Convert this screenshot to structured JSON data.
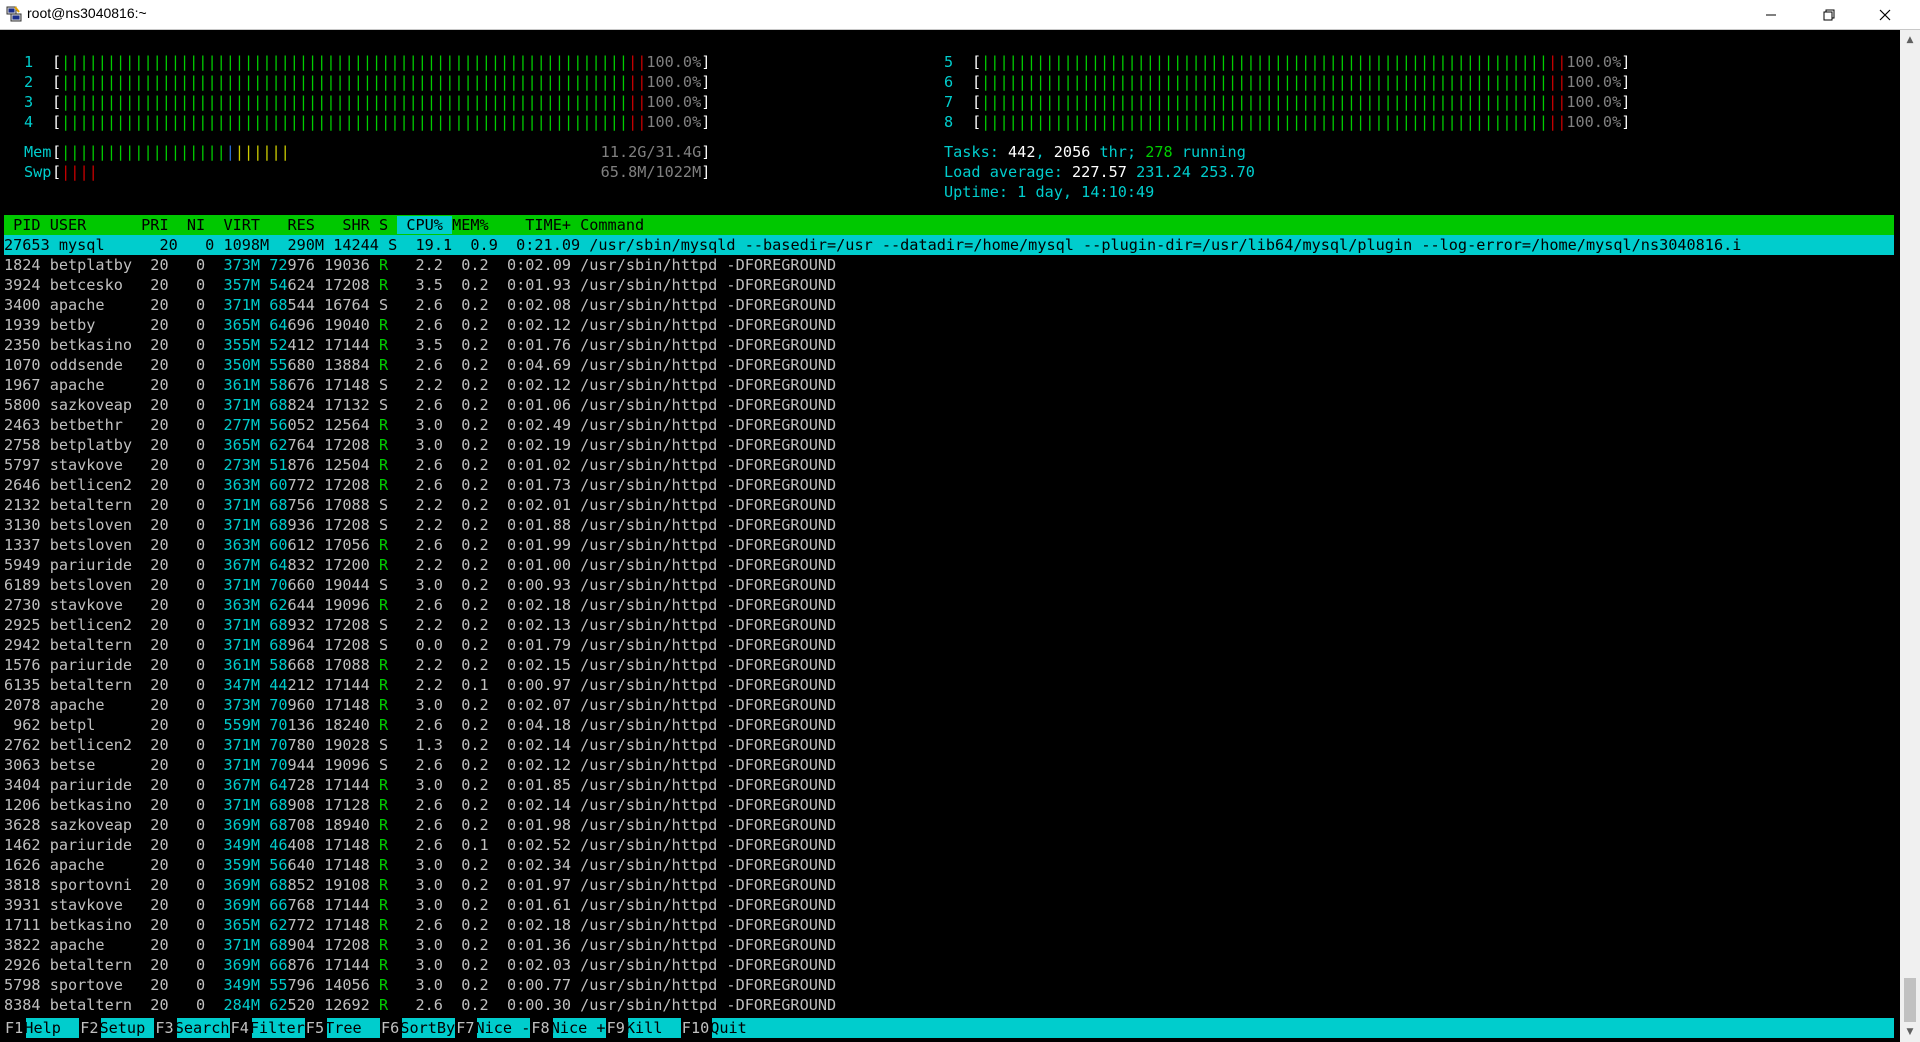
{
  "window": {
    "title": "root@ns3040816:~",
    "icons": {
      "app": "putty-icon",
      "minimize": "minimize-icon",
      "restore": "restore-icon",
      "close": "close-icon"
    }
  },
  "cpus": [
    {
      "id": "1",
      "pct": "100.0%"
    },
    {
      "id": "2",
      "pct": "100.0%"
    },
    {
      "id": "3",
      "pct": "100.0%"
    },
    {
      "id": "4",
      "pct": "100.0%"
    },
    {
      "id": "5",
      "pct": "100.0%"
    },
    {
      "id": "6",
      "pct": "100.0%"
    },
    {
      "id": "7",
      "pct": "100.0%"
    },
    {
      "id": "8",
      "pct": "100.0%"
    }
  ],
  "mem": {
    "label": "Mem",
    "value": "11.2G/31.4G",
    "fraction": 0.36
  },
  "swp": {
    "label": "Swp",
    "value": "65.8M/1022M",
    "fraction": 0.064
  },
  "tasks": {
    "label": "Tasks:",
    "count": "442",
    "sep": ",",
    "threads": "2056",
    "thr_label": "thr;",
    "running": "278",
    "running_label": "running"
  },
  "load": {
    "label": "Load average:",
    "v1": "227.57",
    "v2": "231.24",
    "v3": "253.70"
  },
  "uptime": {
    "label": "Uptime:",
    "value": "1 day, 14:10:49"
  },
  "columns": [
    " PID",
    "USER",
    "PRI",
    "NI",
    "VIRT",
    "RES",
    "SHR",
    "S",
    "CPU%",
    "MEM%",
    "TIME+",
    "Command"
  ],
  "selected": {
    "pid": "27653",
    "user": "mysql",
    "pri": "20",
    "ni": "0",
    "virt": "1098M",
    "res": "290M",
    "shr": "14244",
    "s": "S",
    "cpu": "19.1",
    "mem": "0.9",
    "time": "0:21.09",
    "cmd": "/usr/sbin/mysqld --basedir=/usr --datadir=/home/mysql --plugin-dir=/usr/lib64/mysql/plugin --log-error=/home/mysql/ns3040816.i"
  },
  "processes": [
    {
      "pid": "1824",
      "user": "betplatby",
      "pri": "20",
      "ni": "0",
      "virt": "373M",
      "res": "72976",
      "shr": "19036",
      "s": "R",
      "cpu": "2.2",
      "mem": "0.2",
      "time": "0:02.09",
      "cmd": "/usr/sbin/httpd -DFOREGROUND"
    },
    {
      "pid": "3924",
      "user": "betcesko",
      "pri": "20",
      "ni": "0",
      "virt": "357M",
      "res": "54624",
      "shr": "17208",
      "s": "R",
      "cpu": "3.5",
      "mem": "0.2",
      "time": "0:01.93",
      "cmd": "/usr/sbin/httpd -DFOREGROUND"
    },
    {
      "pid": "3400",
      "user": "apache",
      "pri": "20",
      "ni": "0",
      "virt": "371M",
      "res": "68544",
      "shr": "16764",
      "s": "S",
      "cpu": "2.6",
      "mem": "0.2",
      "time": "0:02.08",
      "cmd": "/usr/sbin/httpd -DFOREGROUND"
    },
    {
      "pid": "1939",
      "user": "betby",
      "pri": "20",
      "ni": "0",
      "virt": "365M",
      "res": "64696",
      "shr": "19040",
      "s": "R",
      "cpu": "2.6",
      "mem": "0.2",
      "time": "0:02.12",
      "cmd": "/usr/sbin/httpd -DFOREGROUND"
    },
    {
      "pid": "2350",
      "user": "betkasino",
      "pri": "20",
      "ni": "0",
      "virt": "355M",
      "res": "52412",
      "shr": "17144",
      "s": "R",
      "cpu": "3.5",
      "mem": "0.2",
      "time": "0:01.76",
      "cmd": "/usr/sbin/httpd -DFOREGROUND"
    },
    {
      "pid": "1070",
      "user": "oddsende",
      "pri": "20",
      "ni": "0",
      "virt": "350M",
      "res": "55680",
      "shr": "13884",
      "s": "R",
      "cpu": "2.6",
      "mem": "0.2",
      "time": "0:04.69",
      "cmd": "/usr/sbin/httpd -DFOREGROUND"
    },
    {
      "pid": "1967",
      "user": "apache",
      "pri": "20",
      "ni": "0",
      "virt": "361M",
      "res": "58676",
      "shr": "17148",
      "s": "S",
      "cpu": "2.2",
      "mem": "0.2",
      "time": "0:02.12",
      "cmd": "/usr/sbin/httpd -DFOREGROUND"
    },
    {
      "pid": "5800",
      "user": "sazkoveap",
      "pri": "20",
      "ni": "0",
      "virt": "371M",
      "res": "68824",
      "shr": "17132",
      "s": "S",
      "cpu": "2.6",
      "mem": "0.2",
      "time": "0:01.06",
      "cmd": "/usr/sbin/httpd -DFOREGROUND"
    },
    {
      "pid": "2463",
      "user": "betbethr",
      "pri": "20",
      "ni": "0",
      "virt": "277M",
      "res": "56052",
      "shr": "12564",
      "s": "R",
      "cpu": "3.0",
      "mem": "0.2",
      "time": "0:02.49",
      "cmd": "/usr/sbin/httpd -DFOREGROUND"
    },
    {
      "pid": "2758",
      "user": "betplatby",
      "pri": "20",
      "ni": "0",
      "virt": "365M",
      "res": "62764",
      "shr": "17208",
      "s": "R",
      "cpu": "3.0",
      "mem": "0.2",
      "time": "0:02.19",
      "cmd": "/usr/sbin/httpd -DFOREGROUND"
    },
    {
      "pid": "5797",
      "user": "stavkove",
      "pri": "20",
      "ni": "0",
      "virt": "273M",
      "res": "51876",
      "shr": "12504",
      "s": "R",
      "cpu": "2.6",
      "mem": "0.2",
      "time": "0:01.02",
      "cmd": "/usr/sbin/httpd -DFOREGROUND"
    },
    {
      "pid": "2646",
      "user": "betlicen2",
      "pri": "20",
      "ni": "0",
      "virt": "363M",
      "res": "60772",
      "shr": "17208",
      "s": "R",
      "cpu": "2.6",
      "mem": "0.2",
      "time": "0:01.73",
      "cmd": "/usr/sbin/httpd -DFOREGROUND"
    },
    {
      "pid": "2132",
      "user": "betaltern",
      "pri": "20",
      "ni": "0",
      "virt": "371M",
      "res": "68756",
      "shr": "17088",
      "s": "S",
      "cpu": "2.2",
      "mem": "0.2",
      "time": "0:02.01",
      "cmd": "/usr/sbin/httpd -DFOREGROUND"
    },
    {
      "pid": "3130",
      "user": "betsloven",
      "pri": "20",
      "ni": "0",
      "virt": "371M",
      "res": "68936",
      "shr": "17208",
      "s": "S",
      "cpu": "2.2",
      "mem": "0.2",
      "time": "0:01.88",
      "cmd": "/usr/sbin/httpd -DFOREGROUND"
    },
    {
      "pid": "1337",
      "user": "betsloven",
      "pri": "20",
      "ni": "0",
      "virt": "363M",
      "res": "60612",
      "shr": "17056",
      "s": "R",
      "cpu": "2.6",
      "mem": "0.2",
      "time": "0:01.99",
      "cmd": "/usr/sbin/httpd -DFOREGROUND"
    },
    {
      "pid": "5949",
      "user": "pariuride",
      "pri": "20",
      "ni": "0",
      "virt": "367M",
      "res": "64832",
      "shr": "17200",
      "s": "R",
      "cpu": "2.2",
      "mem": "0.2",
      "time": "0:01.00",
      "cmd": "/usr/sbin/httpd -DFOREGROUND"
    },
    {
      "pid": "6189",
      "user": "betsloven",
      "pri": "20",
      "ni": "0",
      "virt": "371M",
      "res": "70660",
      "shr": "19044",
      "s": "S",
      "cpu": "3.0",
      "mem": "0.2",
      "time": "0:00.93",
      "cmd": "/usr/sbin/httpd -DFOREGROUND"
    },
    {
      "pid": "2730",
      "user": "stavkove",
      "pri": "20",
      "ni": "0",
      "virt": "363M",
      "res": "62644",
      "shr": "19096",
      "s": "R",
      "cpu": "2.6",
      "mem": "0.2",
      "time": "0:02.18",
      "cmd": "/usr/sbin/httpd -DFOREGROUND"
    },
    {
      "pid": "2925",
      "user": "betlicen2",
      "pri": "20",
      "ni": "0",
      "virt": "371M",
      "res": "68932",
      "shr": "17208",
      "s": "S",
      "cpu": "2.2",
      "mem": "0.2",
      "time": "0:02.13",
      "cmd": "/usr/sbin/httpd -DFOREGROUND"
    },
    {
      "pid": "2942",
      "user": "betaltern",
      "pri": "20",
      "ni": "0",
      "virt": "371M",
      "res": "68964",
      "shr": "17208",
      "s": "S",
      "cpu": "0.0",
      "mem": "0.2",
      "time": "0:01.79",
      "cmd": "/usr/sbin/httpd -DFOREGROUND"
    },
    {
      "pid": "1576",
      "user": "pariuride",
      "pri": "20",
      "ni": "0",
      "virt": "361M",
      "res": "58668",
      "shr": "17088",
      "s": "R",
      "cpu": "2.2",
      "mem": "0.2",
      "time": "0:02.15",
      "cmd": "/usr/sbin/httpd -DFOREGROUND"
    },
    {
      "pid": "6135",
      "user": "betaltern",
      "pri": "20",
      "ni": "0",
      "virt": "347M",
      "res": "44212",
      "shr": "17144",
      "s": "R",
      "cpu": "2.2",
      "mem": "0.1",
      "time": "0:00.97",
      "cmd": "/usr/sbin/httpd -DFOREGROUND"
    },
    {
      "pid": "2078",
      "user": "apache",
      "pri": "20",
      "ni": "0",
      "virt": "373M",
      "res": "70960",
      "shr": "17148",
      "s": "R",
      "cpu": "3.0",
      "mem": "0.2",
      "time": "0:02.07",
      "cmd": "/usr/sbin/httpd -DFOREGROUND"
    },
    {
      "pid": "962",
      "user": "betpl",
      "pri": "20",
      "ni": "0",
      "virt": "559M",
      "res": "70136",
      "shr": "18240",
      "s": "R",
      "cpu": "2.6",
      "mem": "0.2",
      "time": "0:04.18",
      "cmd": "/usr/sbin/httpd -DFOREGROUND"
    },
    {
      "pid": "2762",
      "user": "betlicen2",
      "pri": "20",
      "ni": "0",
      "virt": "371M",
      "res": "70780",
      "shr": "19028",
      "s": "S",
      "cpu": "1.3",
      "mem": "0.2",
      "time": "0:02.14",
      "cmd": "/usr/sbin/httpd -DFOREGROUND"
    },
    {
      "pid": "3063",
      "user": "betse",
      "pri": "20",
      "ni": "0",
      "virt": "371M",
      "res": "70944",
      "shr": "19096",
      "s": "S",
      "cpu": "2.6",
      "mem": "0.2",
      "time": "0:02.12",
      "cmd": "/usr/sbin/httpd -DFOREGROUND"
    },
    {
      "pid": "3404",
      "user": "pariuride",
      "pri": "20",
      "ni": "0",
      "virt": "367M",
      "res": "64728",
      "shr": "17144",
      "s": "R",
      "cpu": "3.0",
      "mem": "0.2",
      "time": "0:01.85",
      "cmd": "/usr/sbin/httpd -DFOREGROUND"
    },
    {
      "pid": "1206",
      "user": "betkasino",
      "pri": "20",
      "ni": "0",
      "virt": "371M",
      "res": "68908",
      "shr": "17128",
      "s": "R",
      "cpu": "2.6",
      "mem": "0.2",
      "time": "0:02.14",
      "cmd": "/usr/sbin/httpd -DFOREGROUND"
    },
    {
      "pid": "3628",
      "user": "sazkoveap",
      "pri": "20",
      "ni": "0",
      "virt": "369M",
      "res": "68708",
      "shr": "18940",
      "s": "R",
      "cpu": "2.6",
      "mem": "0.2",
      "time": "0:01.98",
      "cmd": "/usr/sbin/httpd -DFOREGROUND"
    },
    {
      "pid": "1462",
      "user": "pariuride",
      "pri": "20",
      "ni": "0",
      "virt": "349M",
      "res": "46408",
      "shr": "17148",
      "s": "R",
      "cpu": "2.6",
      "mem": "0.1",
      "time": "0:02.52",
      "cmd": "/usr/sbin/httpd -DFOREGROUND"
    },
    {
      "pid": "1626",
      "user": "apache",
      "pri": "20",
      "ni": "0",
      "virt": "359M",
      "res": "56640",
      "shr": "17148",
      "s": "R",
      "cpu": "3.0",
      "mem": "0.2",
      "time": "0:02.34",
      "cmd": "/usr/sbin/httpd -DFOREGROUND"
    },
    {
      "pid": "3818",
      "user": "sportovni",
      "pri": "20",
      "ni": "0",
      "virt": "369M",
      "res": "68852",
      "shr": "19108",
      "s": "R",
      "cpu": "3.0",
      "mem": "0.2",
      "time": "0:01.97",
      "cmd": "/usr/sbin/httpd -DFOREGROUND"
    },
    {
      "pid": "3931",
      "user": "stavkove",
      "pri": "20",
      "ni": "0",
      "virt": "369M",
      "res": "66768",
      "shr": "17144",
      "s": "R",
      "cpu": "3.0",
      "mem": "0.2",
      "time": "0:01.61",
      "cmd": "/usr/sbin/httpd -DFOREGROUND"
    },
    {
      "pid": "1711",
      "user": "betkasino",
      "pri": "20",
      "ni": "0",
      "virt": "365M",
      "res": "62772",
      "shr": "17148",
      "s": "R",
      "cpu": "2.6",
      "mem": "0.2",
      "time": "0:02.18",
      "cmd": "/usr/sbin/httpd -DFOREGROUND"
    },
    {
      "pid": "3822",
      "user": "apache",
      "pri": "20",
      "ni": "0",
      "virt": "371M",
      "res": "68904",
      "shr": "17208",
      "s": "R",
      "cpu": "3.0",
      "mem": "0.2",
      "time": "0:01.36",
      "cmd": "/usr/sbin/httpd -DFOREGROUND"
    },
    {
      "pid": "2926",
      "user": "betaltern",
      "pri": "20",
      "ni": "0",
      "virt": "369M",
      "res": "66876",
      "shr": "17144",
      "s": "R",
      "cpu": "3.0",
      "mem": "0.2",
      "time": "0:02.03",
      "cmd": "/usr/sbin/httpd -DFOREGROUND"
    },
    {
      "pid": "5798",
      "user": "sportove",
      "pri": "20",
      "ni": "0",
      "virt": "349M",
      "res": "55796",
      "shr": "14056",
      "s": "R",
      "cpu": "3.0",
      "mem": "0.2",
      "time": "0:00.77",
      "cmd": "/usr/sbin/httpd -DFOREGROUND"
    },
    {
      "pid": "8384",
      "user": "betaltern",
      "pri": "20",
      "ni": "0",
      "virt": "284M",
      "res": "62520",
      "shr": "12692",
      "s": "R",
      "cpu": "2.6",
      "mem": "0.2",
      "time": "0:00.30",
      "cmd": "/usr/sbin/httpd -DFOREGROUND"
    }
  ],
  "fkeys": [
    {
      "key": "F1",
      "label": "Help"
    },
    {
      "key": "F2",
      "label": "Setup"
    },
    {
      "key": "F3",
      "label": "Search"
    },
    {
      "key": "F4",
      "label": "Filter"
    },
    {
      "key": "F5",
      "label": "Tree"
    },
    {
      "key": "F6",
      "label": "SortBy"
    },
    {
      "key": "F7",
      "label": "Nice -"
    },
    {
      "key": "F8",
      "label": "Nice +"
    },
    {
      "key": "F9",
      "label": "Kill"
    },
    {
      "key": "F10",
      "label": "Quit"
    }
  ],
  "colors": {
    "header_bg": "#00c800",
    "selected_bg": "#00cdcd",
    "cyan": "#00cdcd",
    "green": "#00cd00",
    "red": "#cd0000",
    "blue": "#2a6fd6"
  }
}
